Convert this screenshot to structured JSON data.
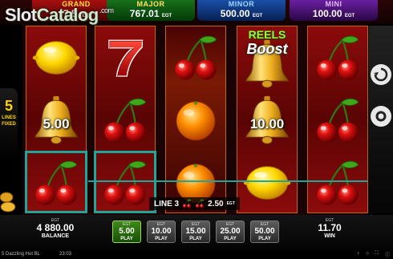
{
  "watermark": {
    "main": "Slot",
    "accent": "Catalog",
    "suffix": ".com"
  },
  "jackpots": {
    "grand": {
      "name": "GRAND",
      "value": "7 5",
      "unit": "EGT"
    },
    "major": {
      "name": "MAJOR",
      "value": "767.01",
      "unit": "EGT"
    },
    "minor": {
      "name": "MINOR",
      "value": "500.00",
      "unit": "EGT"
    },
    "mini": {
      "name": "MINI",
      "value": "100.00",
      "unit": "EGT"
    }
  },
  "side_left": {
    "number": "5",
    "text": "LINES FIXED"
  },
  "reels": {
    "symbols": [
      [
        "lemon",
        "bell",
        "cherries"
      ],
      [
        "seven",
        "cherries",
        "cherries"
      ],
      [
        "cherries",
        "orange",
        "orange"
      ],
      [
        "bell",
        "bell",
        "lemon"
      ],
      [
        "cherries",
        "cherries",
        "cherries"
      ]
    ],
    "bell_values": {
      "reel1": "5.00",
      "reel4": "10.00"
    },
    "reels_boost": {
      "line1": "REELS",
      "line2": "Boost"
    }
  },
  "line_win": {
    "label": "LINE 3",
    "amount": "2.50",
    "unit": "EGT",
    "symbol": "cherries-icon"
  },
  "balance": {
    "unit": "EGT",
    "amount": "4 880.00",
    "label": "BALANCE"
  },
  "win": {
    "unit": "EGT",
    "amount": "11.70",
    "label": "WIN"
  },
  "bets": [
    {
      "unit": "EGT",
      "value": "5.00",
      "label": "PLAY",
      "active": true
    },
    {
      "unit": "EGT",
      "value": "10.00",
      "label": "PLAY",
      "active": false
    },
    {
      "unit": "EGT",
      "value": "15.00",
      "label": "PLAY",
      "active": false
    },
    {
      "unit": "EGT",
      "value": "25.00",
      "label": "PLAY",
      "active": false
    },
    {
      "unit": "EGT",
      "value": "50.00",
      "label": "PLAY",
      "active": false
    }
  ],
  "status_bar": {
    "game_name": "5 Dazzling Hot BL",
    "clock": "23:03"
  },
  "colors": {
    "win_line": "#1fa69a",
    "active_bet": "#3f8a1a",
    "reel_bg": "#8c0b0b",
    "gold": "#ffd400"
  },
  "icons": [
    "cherries-icon",
    "lemon-icon",
    "bell-icon",
    "seven-icon",
    "orange-icon",
    "autoplay-icon",
    "settings-icon",
    "sound-icon",
    "home-icon",
    "fullscreen-icon",
    "info-icon"
  ]
}
